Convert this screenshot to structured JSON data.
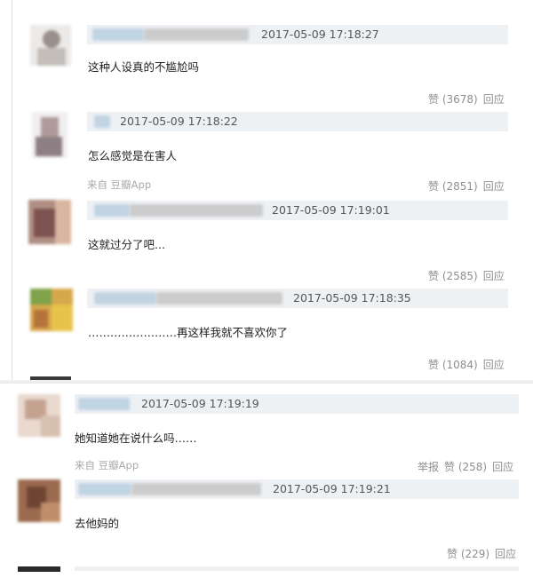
{
  "source_label": "来自 豆瓣App",
  "actions": {
    "reply": "回应",
    "report": "举报"
  },
  "comments": [
    {
      "timestamp": "2017-05-09 17:18:27",
      "text": "这种人设真的不尴尬吗",
      "likes": "赞 (3678)"
    },
    {
      "timestamp": "2017-05-09 17:18:22",
      "text": "怎么感觉是在害人",
      "likes": "赞 (2851)"
    },
    {
      "timestamp": "2017-05-09 17:19:01",
      "text": "这就过分了吧...",
      "likes": "赞 (2585)"
    },
    {
      "timestamp": "2017-05-09 17:18:35",
      "text": "……………………再这样我就不喜欢你了",
      "likes": "赞 (1084)"
    },
    {
      "timestamp": "2017-05-09 17:19:19",
      "text": "她知道她在说什么吗……",
      "likes": "赞 (258)"
    },
    {
      "timestamp": "2017-05-09 17:19:21",
      "text": "去他妈的",
      "likes": "赞 (229)"
    }
  ],
  "colors": {
    "header_bar": "#eef1f4",
    "text": "#222222",
    "meta": "#8f8f8f",
    "source": "#aaaaaa"
  }
}
